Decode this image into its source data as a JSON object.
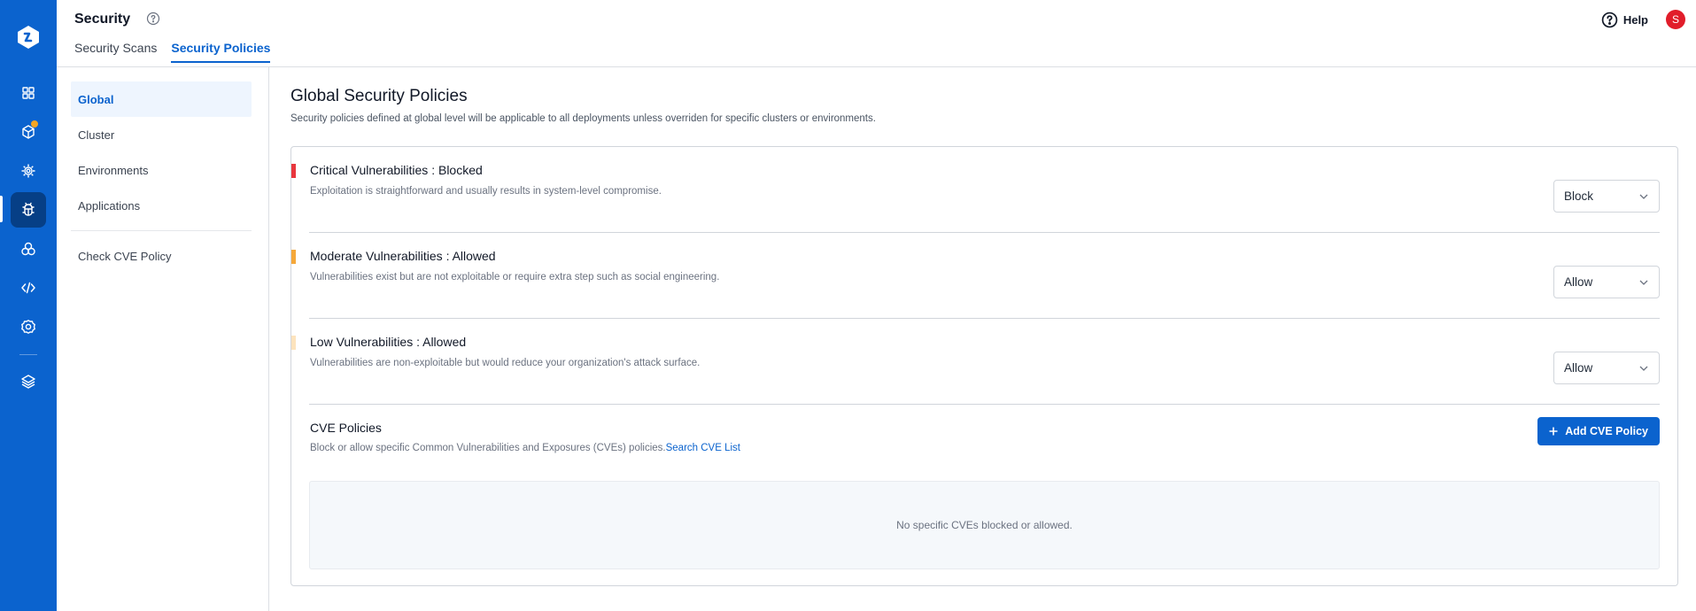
{
  "header": {
    "title": "Security",
    "tabs": [
      {
        "label": "Security Scans",
        "active": false
      },
      {
        "label": "Security Policies",
        "active": true
      }
    ],
    "help_label": "Help",
    "avatar_initial": "S"
  },
  "rail": {
    "items": [
      "dashboard",
      "packages",
      "settings-gear",
      "security-bug",
      "components",
      "code",
      "global-settings",
      "stack"
    ],
    "active": "security-bug",
    "notification_on": "packages"
  },
  "subnav": {
    "items": [
      {
        "label": "Global",
        "active": true
      },
      {
        "label": "Cluster",
        "active": false
      },
      {
        "label": "Environments",
        "active": false
      },
      {
        "label": "Applications",
        "active": false
      }
    ],
    "extra": "Check CVE Policy"
  },
  "main": {
    "title": "Global Security Policies",
    "description": "Security policies defined at global level will be applicable to all deployments unless overriden for specific clusters or environments.",
    "policies": [
      {
        "title": "Critical Vulnerabilities : Blocked",
        "description": "Exploitation is straightforward and usually results in system-level compromise.",
        "value": "Block",
        "color": "#e8363d"
      },
      {
        "title": "Moderate Vulnerabilities : Allowed",
        "description": "Vulnerabilities exist but are not exploitable or require extra step such as social engineering.",
        "value": "Allow",
        "color": "#f5a83a"
      },
      {
        "title": "Low Vulnerabilities : Allowed",
        "description": "Vulnerabilities are non-exploitable but would reduce your organization's attack surface.",
        "value": "Allow",
        "color": "#fde3bd"
      }
    ],
    "cve": {
      "title": "CVE Policies",
      "description": "Block or allow specific Common Vulnerabilities and Exposures (CVEs) policies.",
      "link": "Search CVE List",
      "add_button": "Add CVE Policy",
      "empty_text": "No specific CVEs blocked or allowed."
    }
  }
}
